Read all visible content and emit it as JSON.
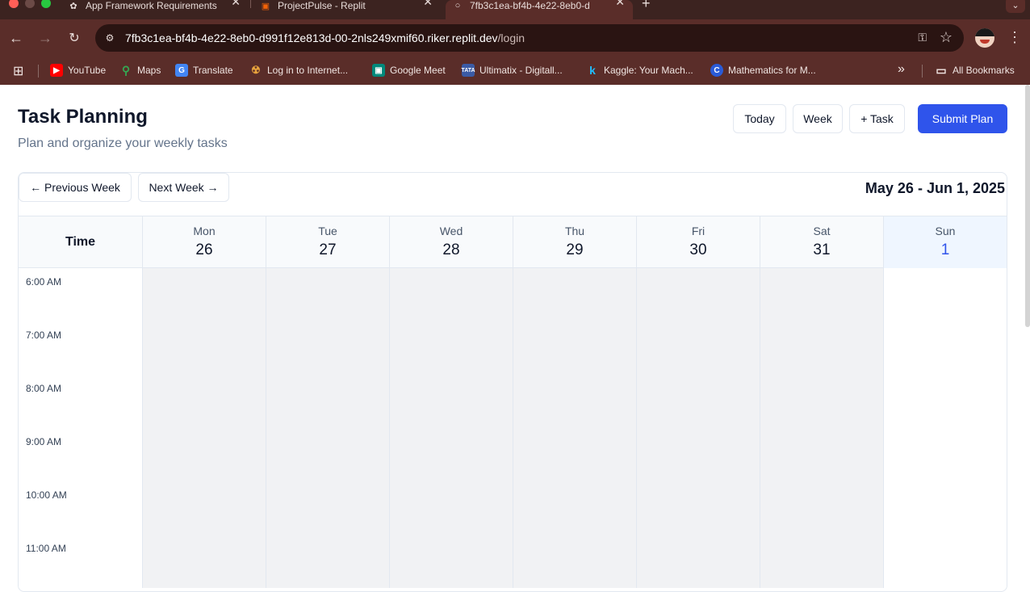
{
  "browser": {
    "tabs": [
      {
        "title": "App Framework Requirements",
        "favicon": "openai-icon",
        "active": false
      },
      {
        "title": "ProjectPulse - Replit",
        "favicon": "replit-icon",
        "active": false
      },
      {
        "title": "7fb3c1ea-bf4b-4e22-8eb0-d",
        "favicon": "globe-icon",
        "active": true
      }
    ],
    "url": {
      "host": "7fb3c1ea-bf4b-4e22-8eb0-d991f12e813d-00-2nls249xmif60.riker.replit.dev",
      "path": "/login"
    },
    "bookmarks": [
      {
        "label": "YouTube",
        "icon_color": "#ff0000"
      },
      {
        "label": "Maps",
        "icon_color": "#34a853"
      },
      {
        "label": "Translate",
        "icon_color": "#4285f4"
      },
      {
        "label": "Log in to Internet...",
        "icon_color": "#e8a33d"
      },
      {
        "label": "Google Meet",
        "icon_color": "#00897b"
      },
      {
        "label": "Ultimatix - Digitall...",
        "icon_color": "#3b5ba5"
      },
      {
        "label": "Kaggle: Your Mach...",
        "icon_color": "#20beff"
      },
      {
        "label": "Mathematics for M...",
        "icon_color": "#2a5bd7"
      }
    ],
    "all_bookmarks_label": "All Bookmarks"
  },
  "header": {
    "title": "Task Planning",
    "subtitle": "Plan and organize your weekly tasks",
    "today_label": "Today",
    "week_label": "Week",
    "add_task_label": "+ Task",
    "submit_label": "Submit Plan"
  },
  "week_nav": {
    "prev_label": "← Previous Week",
    "next_label": "Next Week →",
    "range": "May 26 - Jun 1, 2025"
  },
  "calendar": {
    "time_header": "Time",
    "days": [
      {
        "dow": "Mon",
        "date": "26",
        "today": false
      },
      {
        "dow": "Tue",
        "date": "27",
        "today": false
      },
      {
        "dow": "Wed",
        "date": "28",
        "today": false
      },
      {
        "dow": "Thu",
        "date": "29",
        "today": false
      },
      {
        "dow": "Fri",
        "date": "30",
        "today": false
      },
      {
        "dow": "Sat",
        "date": "31",
        "today": false
      },
      {
        "dow": "Sun",
        "date": "1",
        "today": true
      }
    ],
    "time_slots": [
      "6:00 AM",
      "",
      "7:00 AM",
      "",
      "8:00 AM",
      "",
      "9:00 AM",
      "",
      "10:00 AM",
      "",
      "11:00 AM",
      ""
    ]
  },
  "colors": {
    "accent": "#2f54eb",
    "today_bg": "#eff6ff",
    "past_cell_bg": "#f1f2f4"
  }
}
